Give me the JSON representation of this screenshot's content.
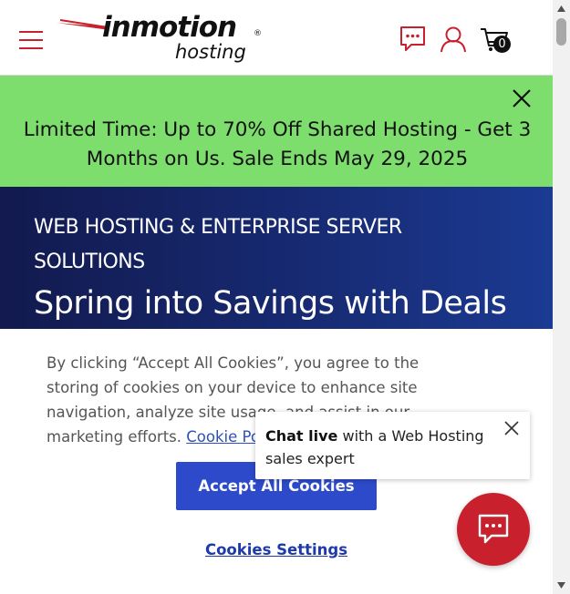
{
  "header": {
    "logo_brand": "inmotion",
    "logo_sub": "hosting",
    "logo_registered": "®",
    "cart_count": "0",
    "icons": [
      "hamburger-menu-icon",
      "chat-bubble-icon",
      "user-account-icon",
      "cart-icon"
    ]
  },
  "promo": {
    "text": "Limited Time: Up to 70% Off Shared Hosting - Get 3 Months on Us. Sale Ends May 29, 2025",
    "background": "#7ddd6d"
  },
  "hero": {
    "eyebrow": "WEB HOSTING & ENTERPRISE SERVER SOLUTIONS",
    "title": "Spring into Savings with Deals"
  },
  "cookie_banner": {
    "text": "By clicking “Accept All Cookies”, you agree to the storing of cookies on your device to enhance site navigation, analyze site usage, and assist in our marketing efforts.",
    "link_label": "Cookie Policy",
    "accept_label": "Accept All Cookies",
    "settings_label": "Cookies Settings"
  },
  "chat": {
    "bold": "Chat live",
    "rest": " with a Web Hosting sales expert"
  },
  "colors": {
    "brand_red": "#c8202d",
    "accept_blue": "#2c4ac9",
    "hero_navy": "#172a72"
  }
}
